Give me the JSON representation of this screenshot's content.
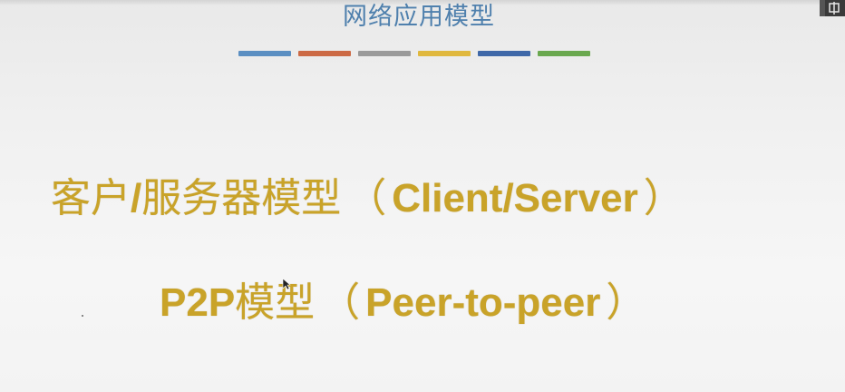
{
  "slide": {
    "title": "网络应用模型",
    "color_bar": [
      "#5b8fc2",
      "#cc6a45",
      "#9a9a9a",
      "#e0b83e",
      "#3f68a8",
      "#6aa84f"
    ],
    "lines": [
      {
        "cn": "客户",
        "slash": "/",
        "cn2": "服务器模型",
        "open": "（",
        "en": "Client/Server",
        "close": "）"
      },
      {
        "en_prefix": "P2P",
        "cn": "模型",
        "open": "（",
        "en": "Peer-to-peer",
        "close": "）"
      }
    ],
    "text_color": "#c9a329",
    "title_color": "#4f80ad"
  }
}
